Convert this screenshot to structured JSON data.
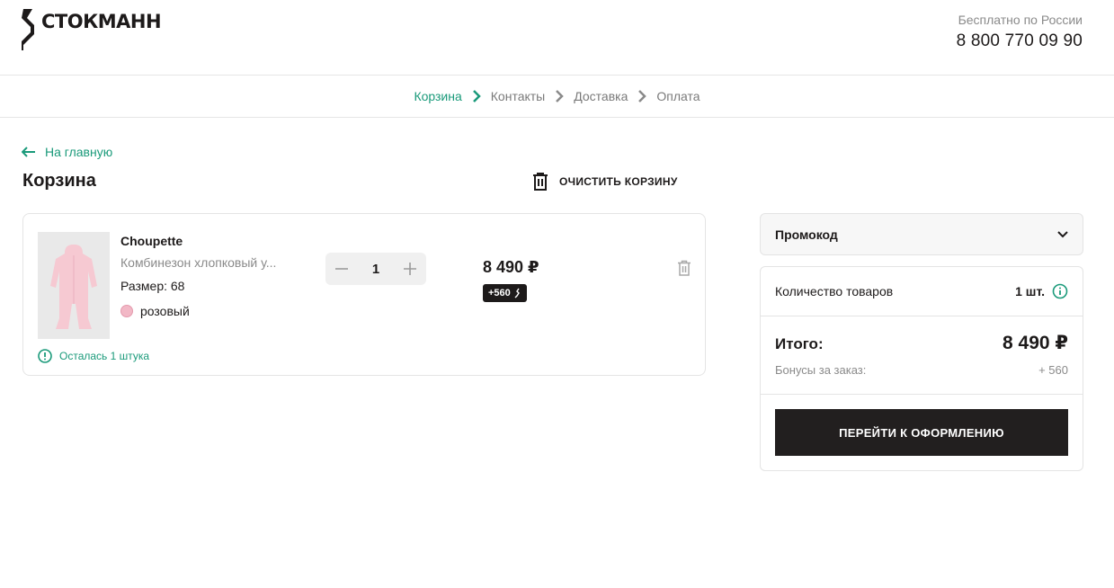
{
  "header": {
    "logo_text": "СТОКМАНН",
    "contact_label": "Бесплатно по России",
    "phone": "8 800 770 09 90"
  },
  "steps": [
    {
      "label": "Корзина",
      "active": true
    },
    {
      "label": "Контакты",
      "active": false
    },
    {
      "label": "Доставка",
      "active": false
    },
    {
      "label": "Оплата",
      "active": false
    }
  ],
  "nav": {
    "back_label": "На главную"
  },
  "cart": {
    "title": "Корзина",
    "clear_label": "ОЧИСТИТЬ КОРЗИНУ",
    "item": {
      "brand": "Choupette",
      "name": "Комбинезон хлопковый у...",
      "size": "Размер: 68",
      "color_name": "розовый",
      "color_hex": "#f2b8c6",
      "stock_note": "Осталась 1 штука",
      "quantity": "1",
      "price": "8 490 ₽",
      "bonus": "+560"
    }
  },
  "summary": {
    "promo_label": "Промокод",
    "count_label": "Количество товаров",
    "count_value": "1 шт.",
    "total_label": "Итого:",
    "total_value": "8 490 ₽",
    "bonus_label": "Бонусы за заказ:",
    "bonus_value": "+ 560",
    "checkout_label": "ПЕРЕЙТИ К ОФОРМЛЕНИЮ"
  },
  "colors": {
    "accent": "#1a9a7a",
    "dark": "#221f1f",
    "muted": "#8a8a8a"
  }
}
